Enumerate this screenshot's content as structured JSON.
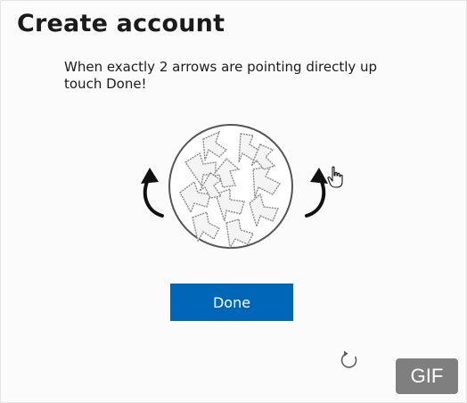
{
  "page": {
    "title": "Create account",
    "instruction": "When exactly 2 arrows are pointing directly up touch Done!"
  },
  "puzzle": {
    "rotate_left_icon": "rotate-counterclockwise-icon",
    "rotate_right_icon": "rotate-clockwise-icon",
    "image_icon": "arrow-puzzle-image"
  },
  "actions": {
    "done_label": "Done",
    "refresh_icon": "refresh-icon"
  },
  "badge": {
    "label": "GIF"
  },
  "colors": {
    "primary": "#0067b8",
    "badge_bg": "#7f7f7f",
    "text": "#1b1b1b"
  }
}
